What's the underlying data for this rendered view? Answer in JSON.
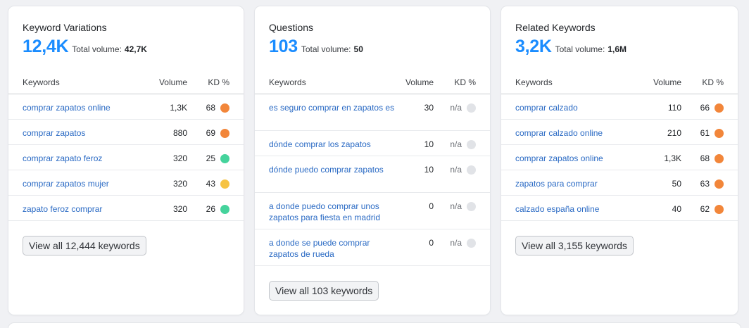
{
  "kd_colors": {
    "orange": "#f2863a",
    "green": "#45d39c",
    "yellow": "#f6c343",
    "gray": "#e1e3e7"
  },
  "column_headers": {
    "keywords": "Keywords",
    "volume": "Volume",
    "kd": "KD %"
  },
  "cards": [
    {
      "title": "Keyword Variations",
      "count": "12,4K",
      "total_label": "Total volume:",
      "total_value": "42,7K",
      "rows": [
        {
          "keyword": "comprar zapatos online",
          "volume": "1,3K",
          "kd": "68",
          "color": "orange"
        },
        {
          "keyword": "comprar zapatos",
          "volume": "880",
          "kd": "69",
          "color": "orange"
        },
        {
          "keyword": "comprar zapato feroz",
          "volume": "320",
          "kd": "25",
          "color": "green"
        },
        {
          "keyword": "comprar zapatos mujer",
          "volume": "320",
          "kd": "43",
          "color": "yellow"
        },
        {
          "keyword": "zapato feroz comprar",
          "volume": "320",
          "kd": "26",
          "color": "green"
        }
      ],
      "button": "View all 12,444 keywords"
    },
    {
      "title": "Questions",
      "count": "103",
      "total_label": "Total volume:",
      "total_value": "50",
      "rows": [
        {
          "keyword": "es seguro comprar en zapatos es",
          "volume": "30",
          "kd": "n/a",
          "color": "gray"
        },
        {
          "keyword": "dónde comprar los zapatos",
          "volume": "10",
          "kd": "n/a",
          "color": "gray"
        },
        {
          "keyword": "dónde puedo comprar zapatos",
          "volume": "10",
          "kd": "n/a",
          "color": "gray"
        },
        {
          "keyword": "a donde puedo comprar unos zapatos para fiesta en madrid",
          "volume": "0",
          "kd": "n/a",
          "color": "gray"
        },
        {
          "keyword": "a donde se puede comprar zapatos de rueda",
          "volume": "0",
          "kd": "n/a",
          "color": "gray"
        }
      ],
      "button": "View all 103 keywords"
    },
    {
      "title": "Related Keywords",
      "count": "3,2K",
      "total_label": "Total volume:",
      "total_value": "1,6M",
      "rows": [
        {
          "keyword": "comprar calzado",
          "volume": "110",
          "kd": "66",
          "color": "orange"
        },
        {
          "keyword": "comprar calzado online",
          "volume": "210",
          "kd": "61",
          "color": "orange"
        },
        {
          "keyword": "comprar zapatos online",
          "volume": "1,3K",
          "kd": "68",
          "color": "orange"
        },
        {
          "keyword": "zapatos para comprar",
          "volume": "50",
          "kd": "63",
          "color": "orange"
        },
        {
          "keyword": "calzado españa online",
          "volume": "40",
          "kd": "62",
          "color": "orange"
        }
      ],
      "button": "View all 3,155 keywords"
    }
  ]
}
